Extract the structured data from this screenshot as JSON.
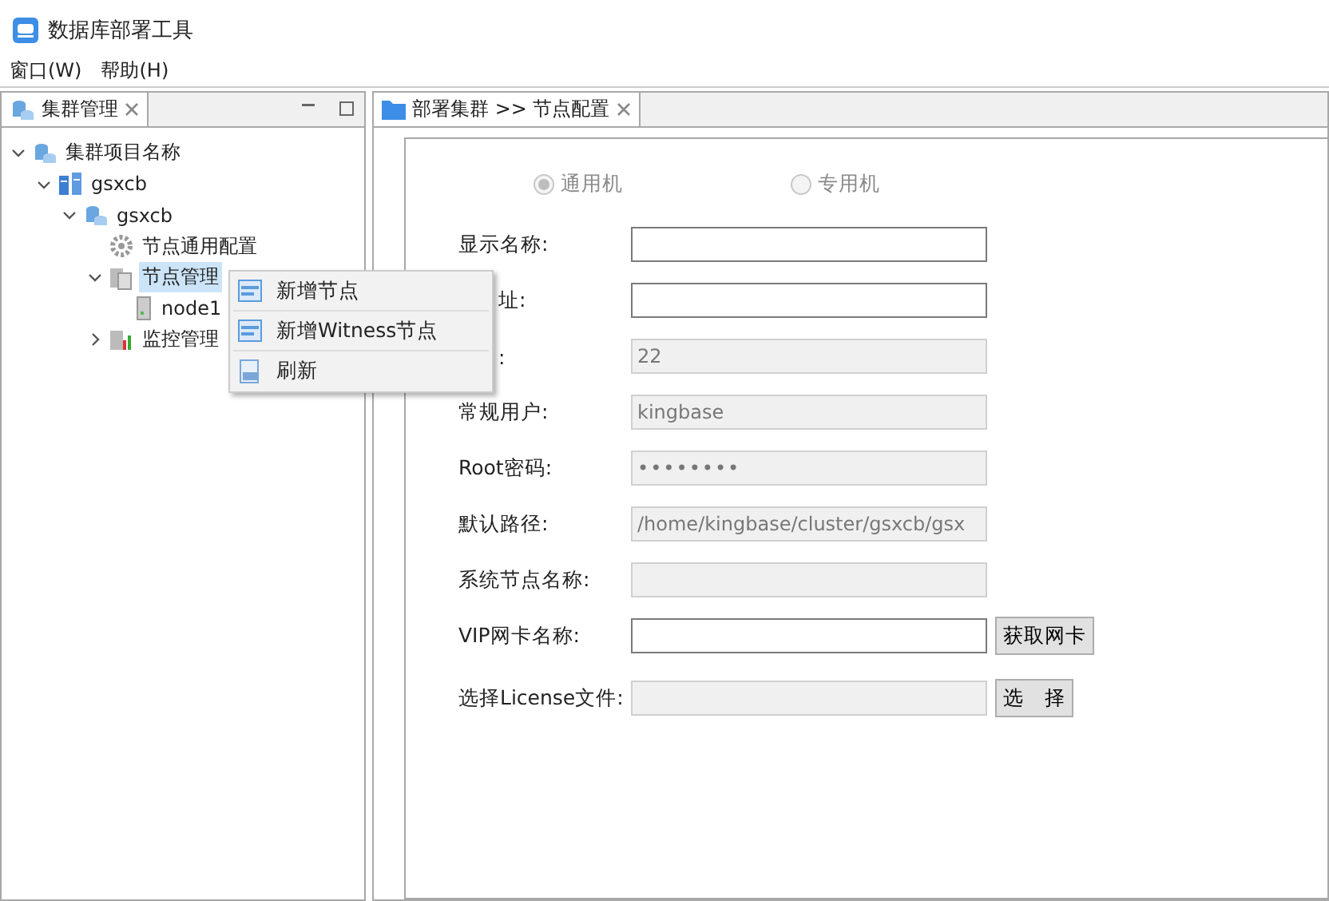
{
  "window": {
    "title": "数据库部署工具"
  },
  "menu_bar": [
    "窗口(W)",
    "帮助(H)"
  ],
  "left_panel": {
    "tab": {
      "label": "集群管理",
      "selected": true
    },
    "tree": [
      {
        "label": "集群项目名称",
        "kind": "cluster",
        "expanded": true,
        "selected": false,
        "children": [
          {
            "label": "gsxcb",
            "kind": "server",
            "expanded": true,
            "selected": false,
            "children": [
              {
                "label": "gsxcb",
                "kind": "cluster",
                "expanded": true,
                "selected": false,
                "children": [
                  {
                    "label": "节点通用配置",
                    "kind": "config",
                    "selected": false
                  },
                  {
                    "label": "节点管理",
                    "kind": "nodes",
                    "expanded": true,
                    "selected": true,
                    "children": [
                      {
                        "label": "node1",
                        "kind": "node",
                        "selected": false
                      }
                    ]
                  },
                  {
                    "label": "监控管理",
                    "kind": "monitor",
                    "expanded": false,
                    "selected": false
                  }
                ]
              }
            ]
          }
        ]
      }
    ]
  },
  "context_menu": [
    {
      "label": "新增节点",
      "kind": "add"
    },
    {
      "label": "新增Witness节点",
      "kind": "add"
    },
    {
      "label": "刷新",
      "kind": "refresh"
    }
  ],
  "editor": {
    "tab": {
      "label": "部署集群 >> 节点配置",
      "selected": true
    },
    "machine_type": [
      {
        "label": "通用机",
        "selected": true
      },
      {
        "label": "专用机",
        "selected": false
      }
    ],
    "fields": [
      {
        "label": "显示名称:",
        "covered": false,
        "kind": "text",
        "enabled": true
      },
      {
        "label": "址:",
        "covered": true,
        "kind": "text",
        "enabled": true
      },
      {
        "label": ":",
        "covered": true,
        "kind": "text",
        "enabled": false,
        "value": "22"
      },
      {
        "label": "常规用户:",
        "covered": false,
        "kind": "text",
        "enabled": false,
        "value": "kingbase"
      },
      {
        "label": "Root密码:",
        "covered": false,
        "kind": "password",
        "enabled": false,
        "value": "••••••••"
      },
      {
        "label": "默认路径:",
        "covered": false,
        "kind": "text",
        "enabled": false,
        "value": "/home/kingbase/cluster/gsxcb/gsx"
      },
      {
        "label": "系统节点名称:",
        "covered": false,
        "kind": "text",
        "enabled": false
      },
      {
        "label": "VIP网卡名称:",
        "covered": false,
        "kind": "text",
        "enabled": true,
        "button": "获取网卡"
      },
      {
        "label": "选择License文件:",
        "covered": false,
        "kind": "text",
        "enabled": false,
        "button": "选　择"
      }
    ]
  }
}
